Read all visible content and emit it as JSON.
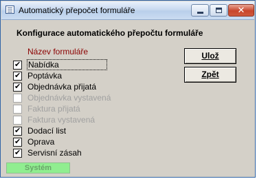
{
  "window": {
    "title": "Automatický přepočet formuláře",
    "close_glyph": "✕"
  },
  "form": {
    "heading": "Konfigurace automatického přepočtu formuláře",
    "list_label": "Název formuláře",
    "items": [
      {
        "label": "Nabídka",
        "checked": true,
        "enabled": true
      },
      {
        "label": "Poptávka",
        "checked": true,
        "enabled": true
      },
      {
        "label": "Objednávka přijatá",
        "checked": true,
        "enabled": true
      },
      {
        "label": "Objednávka vystavená",
        "checked": false,
        "enabled": false
      },
      {
        "label": "Faktura přijatá",
        "checked": false,
        "enabled": false
      },
      {
        "label": "Faktura vystavená",
        "checked": false,
        "enabled": false
      },
      {
        "label": "Dodací list",
        "checked": true,
        "enabled": true
      },
      {
        "label": "Oprava",
        "checked": true,
        "enabled": true
      },
      {
        "label": "Servisní zásah",
        "checked": true,
        "enabled": true
      }
    ],
    "check_glyph": "✔"
  },
  "buttons": {
    "save_label": "Ulož",
    "back_label": "Zpět"
  },
  "status": {
    "label": "Systém",
    "color": "#90ee90"
  },
  "colors": {
    "list_label": "#8b0000",
    "window_bg": "#d4d0c8"
  }
}
